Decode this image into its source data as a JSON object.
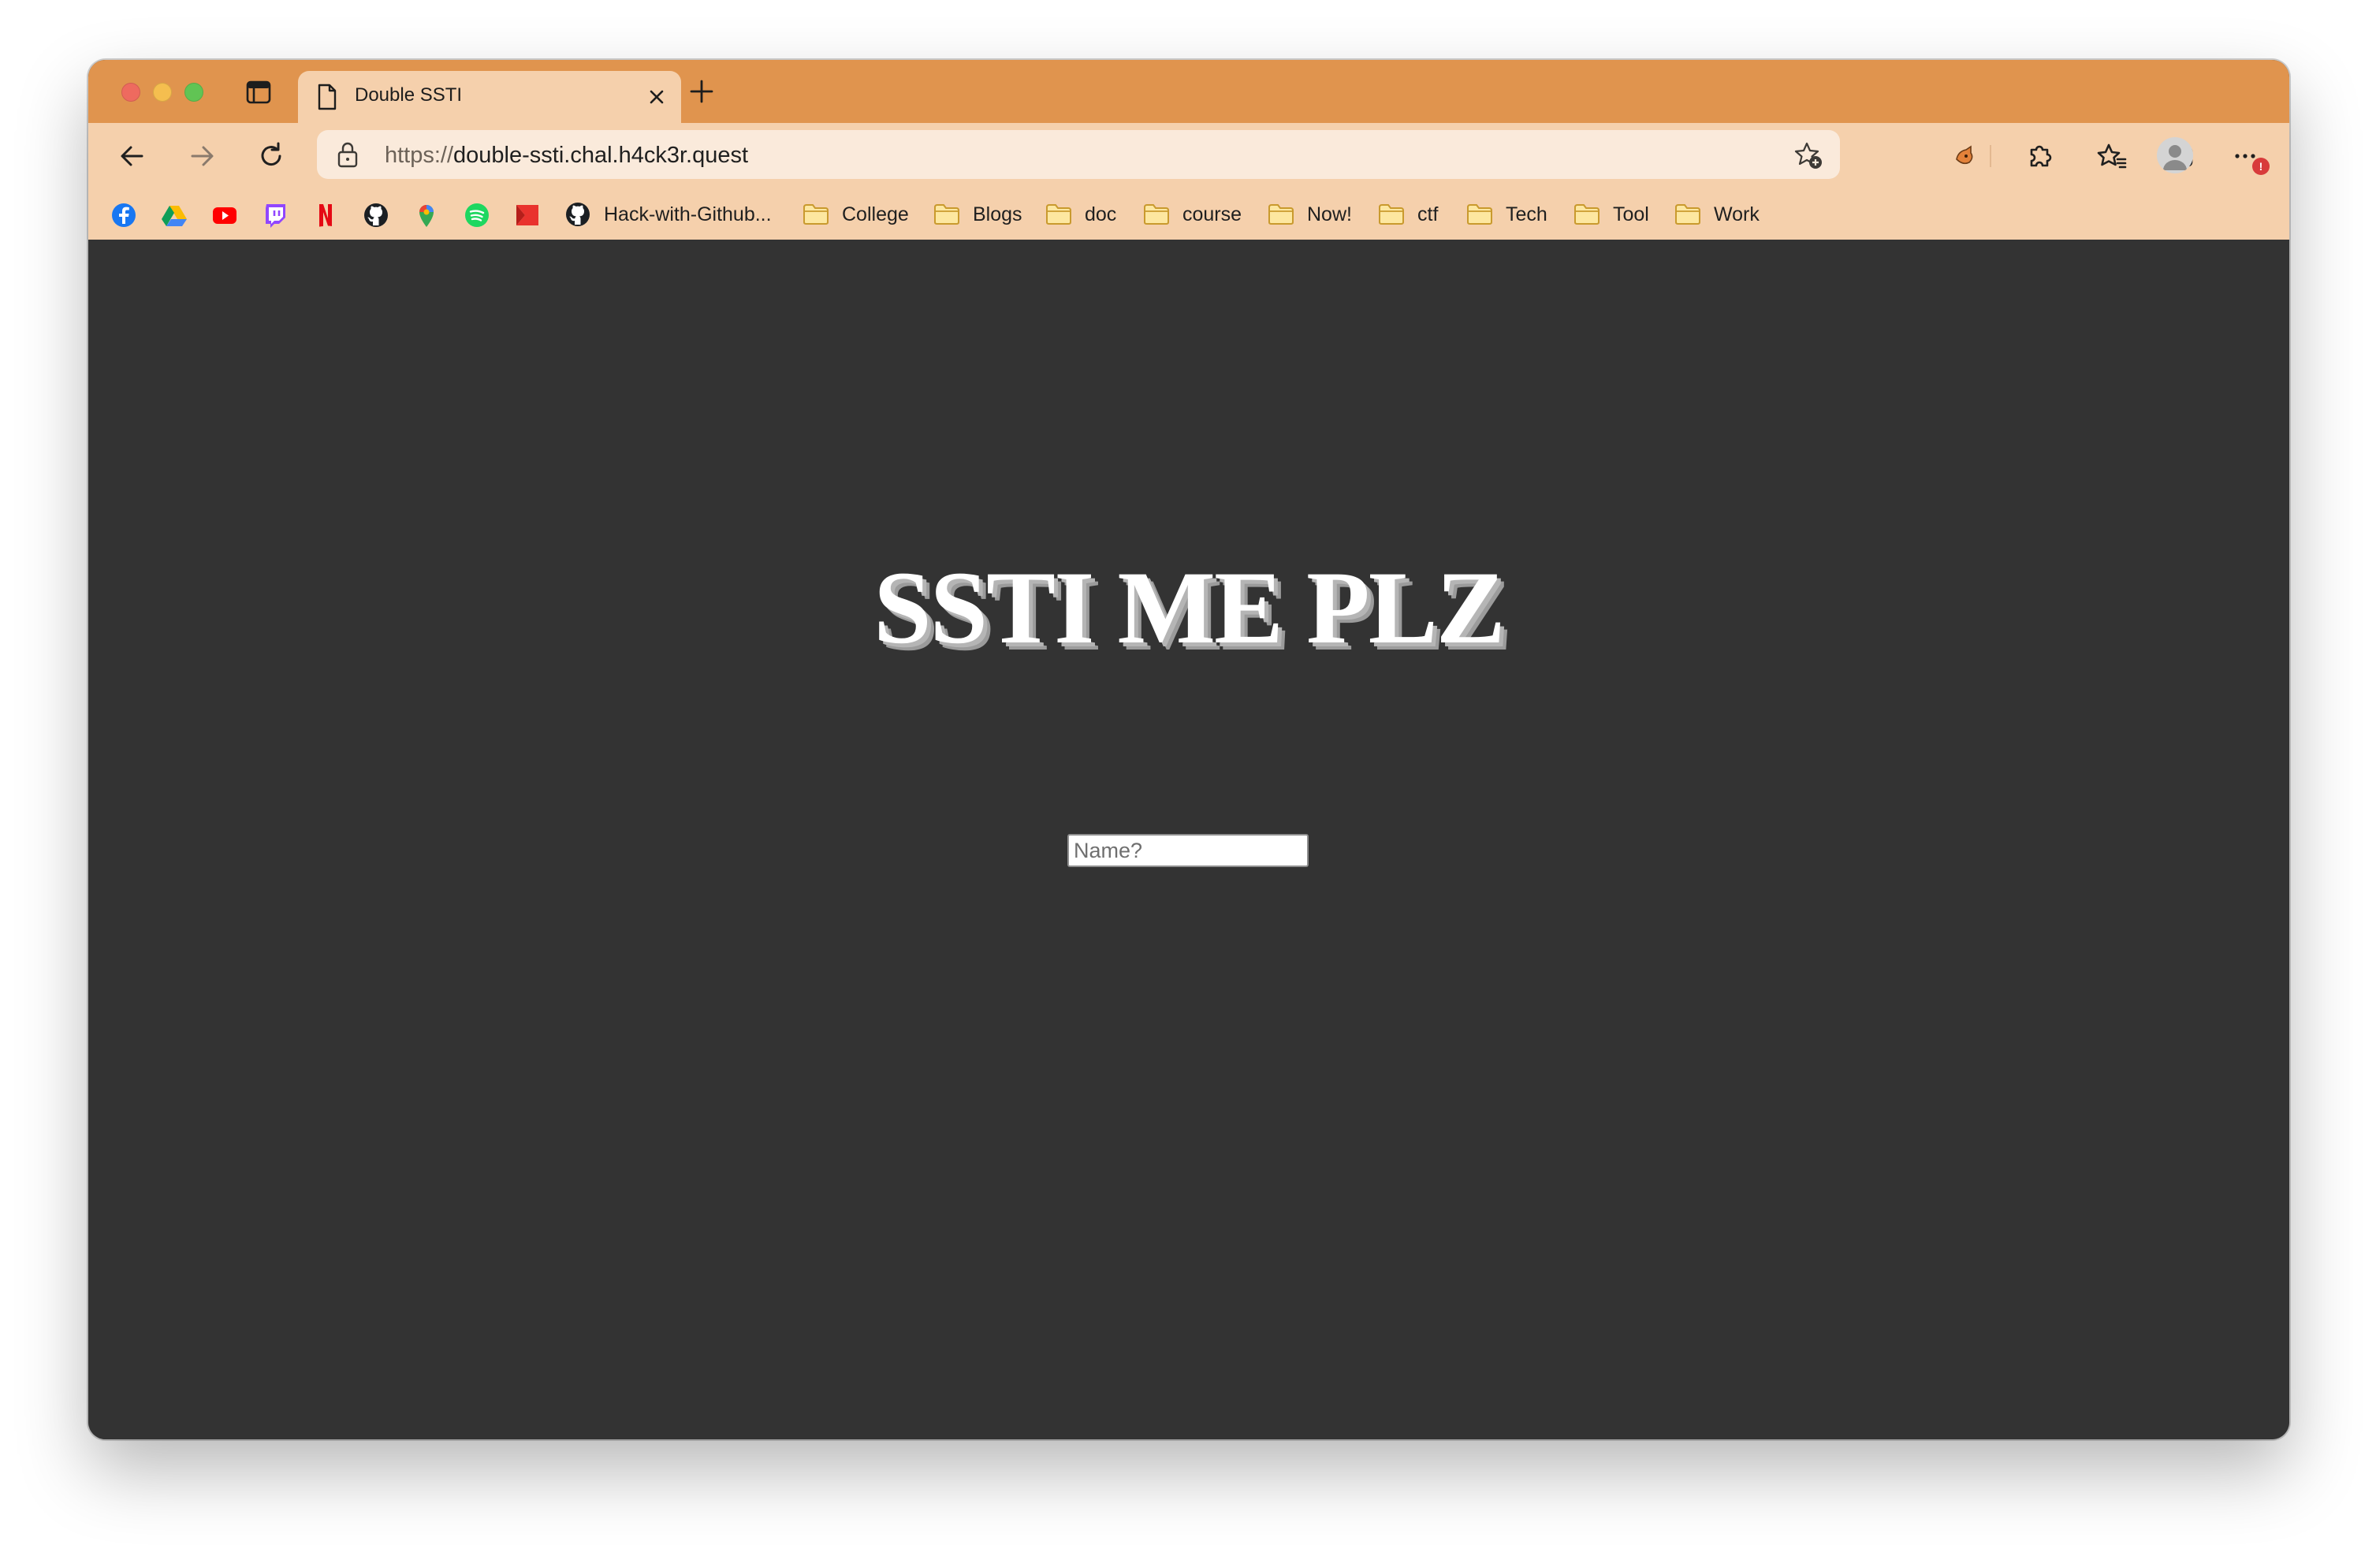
{
  "browser": {
    "tab": {
      "title": "Double SSTI"
    },
    "address_bar": {
      "url_scheme": "https://",
      "url_host": "double-ssti.chal.h4ck3r.quest"
    },
    "more_menu_badge": "!",
    "colors": {
      "tab_strip": "#e0944e",
      "toolbar": "#f5d0ac",
      "page_background": "#333333"
    },
    "toolbar_icons": [
      "back-icon",
      "forward-icon",
      "refresh-icon",
      "lock-icon",
      "add-favorite-icon",
      "extension-fox-icon",
      "extensions-icon",
      "favorites-icon",
      "collections-icon",
      "profile-avatar",
      "more-icon"
    ]
  },
  "bookmarks": {
    "favicons": [
      "facebook-icon",
      "google-drive-icon",
      "youtube-icon",
      "twitch-icon",
      "netflix-icon",
      "github-icon",
      "google-maps-icon",
      "spotify-icon",
      "bookmark-red-icon"
    ],
    "items": [
      {
        "label": "Hack-with-Github...",
        "icon": "github-icon"
      },
      {
        "label": "College",
        "icon": "folder-icon"
      },
      {
        "label": "Blogs",
        "icon": "folder-icon"
      },
      {
        "label": "doc",
        "icon": "folder-icon"
      },
      {
        "label": "course",
        "icon": "folder-icon"
      },
      {
        "label": "Now!",
        "icon": "folder-icon"
      },
      {
        "label": "ctf",
        "icon": "folder-icon"
      },
      {
        "label": "Tech",
        "icon": "folder-icon"
      },
      {
        "label": "Tool",
        "icon": "folder-icon"
      },
      {
        "label": "Work",
        "icon": "folder-icon"
      }
    ]
  },
  "page": {
    "heading": "SSTI ME PLZ",
    "name_input": {
      "placeholder": "Name?",
      "value": ""
    }
  }
}
